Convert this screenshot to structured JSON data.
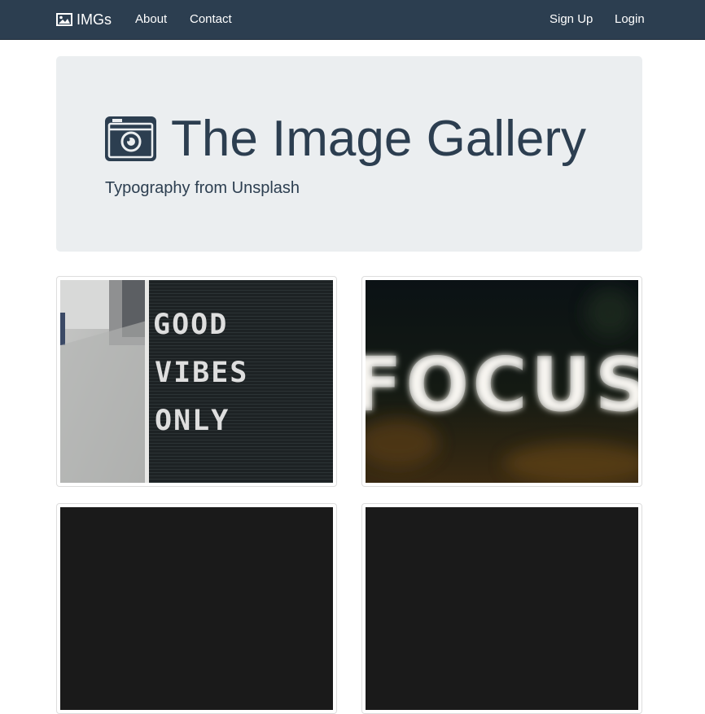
{
  "navbar": {
    "brand": "IMGs",
    "brand_icon": "image-icon",
    "links_left": [
      "About",
      "Contact"
    ],
    "links_right": [
      "Sign Up",
      "Login"
    ]
  },
  "jumbotron": {
    "icon": "camera-icon",
    "title": "The Image Gallery",
    "subtitle": "Typography from Unsplash"
  },
  "gallery": {
    "photos": [
      {
        "depicts": "letter board",
        "text": [
          "GOOD",
          "VIBES",
          "ONLY"
        ]
      },
      {
        "depicts": "bokeh marquee sign",
        "text": [
          "FOCUS"
        ]
      }
    ]
  },
  "colors": {
    "navbar_bg": "#2c3e50",
    "jumbotron_bg": "#ebeef0",
    "primary_text": "#2c3e50"
  }
}
